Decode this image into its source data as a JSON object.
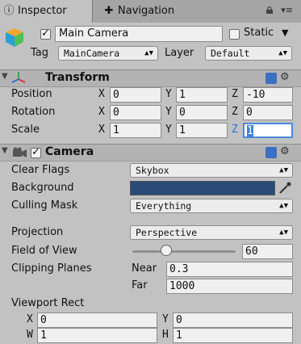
{
  "tabs": [
    {
      "label": "Inspector",
      "icon": "info-icon"
    },
    {
      "label": "Navigation",
      "icon": "navigation-icon"
    }
  ],
  "object": {
    "name": "Main Camera",
    "static_label": "Static",
    "tag_label": "Tag",
    "tag_value": "MainCamera",
    "layer_label": "Layer",
    "layer_value": "Default"
  },
  "transform": {
    "title": "Transform",
    "position_label": "Position",
    "rotation_label": "Rotation",
    "scale_label": "Scale",
    "position": {
      "x": "0",
      "y": "1",
      "z": "-10"
    },
    "rotation": {
      "x": "0",
      "y": "0",
      "z": "0"
    },
    "scale": {
      "x": "1",
      "y": "1",
      "z": "1"
    }
  },
  "axes": {
    "x": "X",
    "y": "Y",
    "z": "Z",
    "w": "W",
    "h": "H"
  },
  "camera": {
    "title": "Camera",
    "clear_flags_label": "Clear Flags",
    "clear_flags_value": "Skybox",
    "background_label": "Background",
    "background_color": "#2b4a78",
    "culling_mask_label": "Culling Mask",
    "culling_mask_value": "Everything",
    "projection_label": "Projection",
    "projection_value": "Perspective",
    "fov_label": "Field of View",
    "fov_value": "60",
    "fov_fraction": 0.33,
    "clipping_label": "Clipping Planes",
    "near_label": "Near",
    "near_value": "0.3",
    "far_label": "Far",
    "far_value": "1000",
    "viewport_label": "Viewport Rect",
    "viewport": {
      "x": "0",
      "y": "0",
      "w": "1",
      "h": "1"
    }
  }
}
